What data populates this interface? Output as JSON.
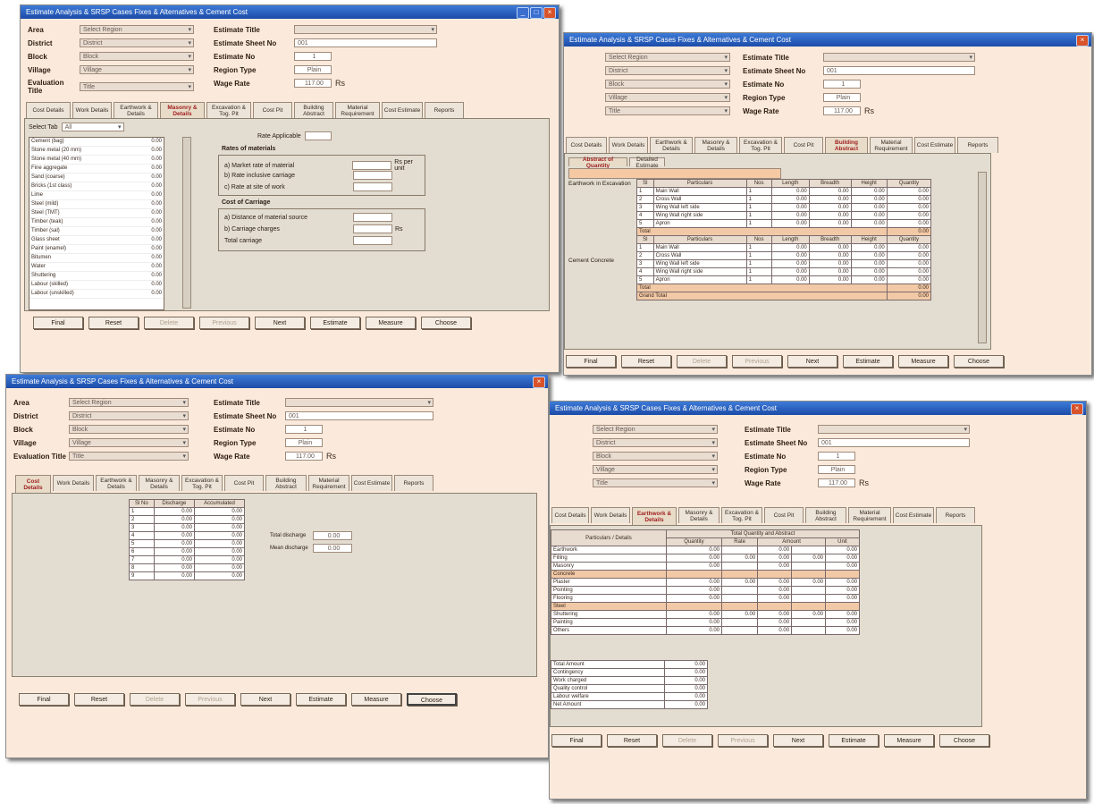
{
  "colors": {
    "titlebar": "#1c4ba8",
    "window": "#fbeadb",
    "panel": "#e2ddd0",
    "accent": "#a02020",
    "summary": "#f2c9a6"
  },
  "window_title": "Estimate Analysis & SRSP Cases Fixes & Alternatives & Cement Cost",
  "header": {
    "labels": [
      "Area",
      "District",
      "Block",
      "Village",
      "Evaluation Title"
    ],
    "values": [
      "Select Region",
      "District",
      "Block",
      "Village",
      "Title"
    ],
    "right_labels": [
      "Estimate Title",
      "Estimate Sheet No",
      "Estimate No",
      "Region Type",
      "Wage Rate"
    ],
    "sheet_no": "001",
    "estimate_no": "1",
    "region_type": "Plain",
    "wage_rate": "117.00",
    "wage_unit": "Rs"
  },
  "tabs": [
    "Cost Details",
    "Work Details",
    "Earthwork & Details",
    "Masonry & Details",
    "Excavation & Tog. Pit",
    "Cost Pit",
    "Building Abstract",
    "Material Requirement",
    "Cost Estimate",
    "Reports"
  ],
  "buttons": [
    "Final",
    "Reset",
    "Delete",
    "Previous",
    "Next",
    "Estimate",
    "Measure",
    "Choose"
  ],
  "w1": {
    "filter_label": "Select Tab",
    "filter_value": "All",
    "items": [
      {
        "name": "Cement (bag)",
        "value": "0.00"
      },
      {
        "name": "Stone metal (20 mm)",
        "value": "0.00"
      },
      {
        "name": "Stone metal (40 mm)",
        "value": "0.00"
      },
      {
        "name": "Fine aggregate",
        "value": "0.00"
      },
      {
        "name": "Sand (coarse)",
        "value": "0.00"
      },
      {
        "name": "Bricks (1st class)",
        "value": "0.00"
      },
      {
        "name": "Lime",
        "value": "0.00"
      },
      {
        "name": "Steel (mild)",
        "value": "0.00"
      },
      {
        "name": "Steel (TMT)",
        "value": "0.00"
      },
      {
        "name": "Timber (teak)",
        "value": "0.00"
      },
      {
        "name": "Timber (sal)",
        "value": "0.00"
      },
      {
        "name": "Glass sheet",
        "value": "0.00"
      },
      {
        "name": "Paint (enamel)",
        "value": "0.00"
      },
      {
        "name": "Bitumen",
        "value": "0.00"
      },
      {
        "name": "Water",
        "value": "0.00"
      },
      {
        "name": "Shuttering",
        "value": "0.00"
      },
      {
        "name": "Labour (skilled)",
        "value": "0.00"
      },
      {
        "name": "Labour (unskilled)",
        "value": "0.00"
      }
    ],
    "rate_label": "Rate Applicable",
    "rate_value": "",
    "group1_title": "Rates of materials",
    "g1_rows": [
      "a) Market rate of material",
      "b) Rate inclusive carriage",
      "c) Rate at site of work"
    ],
    "g1_suffix": "Rs per unit",
    "group2_title": "Cost of Carriage",
    "g2_rows": [
      "a) Distance of material source",
      "b) Carriage charges",
      "Total carriage"
    ],
    "g2_suffix": "Rs"
  },
  "w2": {
    "subtabs": [
      "Abstract of Quantity",
      "Detailed Estimate"
    ],
    "headers": [
      "Sl",
      "Particulars",
      "Nos",
      "Length",
      "Breadth",
      "Height",
      "Quantity"
    ],
    "item1_label": "Earthwork in Excavation",
    "item2_label": "Cement Concrete",
    "rows1": [
      [
        "1",
        "Main Wall",
        "1",
        "0.00",
        "0.00",
        "0.00",
        "0.00"
      ],
      [
        "2",
        "Cross Wall",
        "1",
        "0.00",
        "0.00",
        "0.00",
        "0.00"
      ],
      [
        "3",
        "Wing Wall left side",
        "1",
        "0.00",
        "0.00",
        "0.00",
        "0.00"
      ],
      [
        "4",
        "Wing Wall right side",
        "1",
        "0.00",
        "0.00",
        "0.00",
        "0.00"
      ],
      [
        "5",
        "Apron",
        "1",
        "0.00",
        "0.00",
        "0.00",
        "0.00"
      ]
    ],
    "rows2": [
      [
        "1",
        "Main Wall",
        "1",
        "0.00",
        "0.00",
        "0.00",
        "0.00"
      ],
      [
        "2",
        "Cross Wall",
        "1",
        "0.00",
        "0.00",
        "0.00",
        "0.00"
      ],
      [
        "3",
        "Wing Wall left side",
        "1",
        "0.00",
        "0.00",
        "0.00",
        "0.00"
      ],
      [
        "4",
        "Wing Wall right side",
        "1",
        "0.00",
        "0.00",
        "0.00",
        "0.00"
      ],
      [
        "5",
        "Apron",
        "1",
        "0.00",
        "0.00",
        "0.00",
        "0.00"
      ]
    ],
    "total_label": "Total",
    "total1": "0.00",
    "total2": "0.00",
    "grand_label": "Grand Total",
    "grand_value": "0.00"
  },
  "w3": {
    "headers": [
      "Sl No",
      "Discharge",
      "Accumulated"
    ],
    "rows": [
      [
        "1",
        "0.00",
        "0.00"
      ],
      [
        "2",
        "0.00",
        "0.00"
      ],
      [
        "3",
        "0.00",
        "0.00"
      ],
      [
        "4",
        "0.00",
        "0.00"
      ],
      [
        "5",
        "0.00",
        "0.00"
      ],
      [
        "6",
        "0.00",
        "0.00"
      ],
      [
        "7",
        "0.00",
        "0.00"
      ],
      [
        "8",
        "0.00",
        "0.00"
      ],
      [
        "9",
        "0.00",
        "0.00"
      ]
    ],
    "field1_label": "Total discharge",
    "field1_value": "0.00",
    "field2_label": "Mean discharge",
    "field2_value": "0.00"
  },
  "w4": {
    "head_left": "Particulars / Details",
    "head_group": "Total Quantity and Abstract",
    "head_sub": [
      "Quantity",
      "Rate",
      "Amount",
      "Unit"
    ],
    "rows": [
      [
        "Earthwork",
        "0.00",
        "",
        "0.00",
        "",
        "0.00"
      ],
      [
        "Filling",
        "0.00",
        "0.00",
        "0.00",
        "0.00",
        "0.00"
      ],
      [
        "Masonry",
        "0.00",
        "",
        "0.00",
        "",
        "0.00"
      ],
      [
        "Concrete",
        "",
        "",
        "",
        "",
        ""
      ],
      [
        "Plaster",
        "0.00",
        "0.00",
        "0.00",
        "0.00",
        "0.00"
      ],
      [
        "Pointing",
        "0.00",
        "",
        "0.00",
        "",
        "0.00"
      ],
      [
        "Flooring",
        "0.00",
        "",
        "0.00",
        "",
        "0.00"
      ],
      [
        "Steel",
        "",
        "",
        "",
        "",
        ""
      ],
      [
        "Shuttering",
        "0.00",
        "0.00",
        "0.00",
        "0.00",
        "0.00"
      ],
      [
        "Painting",
        "0.00",
        "",
        "0.00",
        "",
        "0.00"
      ],
      [
        "Others",
        "0.00",
        "",
        "0.00",
        "",
        "0.00"
      ]
    ],
    "summary": [
      [
        "Total Amount",
        "0.00"
      ],
      [
        "Contingency",
        "0.00"
      ],
      [
        "Work charged",
        "0.00"
      ],
      [
        "Quality control",
        "0.00"
      ],
      [
        "Labour welfare",
        "0.00"
      ],
      [
        "Net Amount",
        "0.00"
      ]
    ]
  }
}
